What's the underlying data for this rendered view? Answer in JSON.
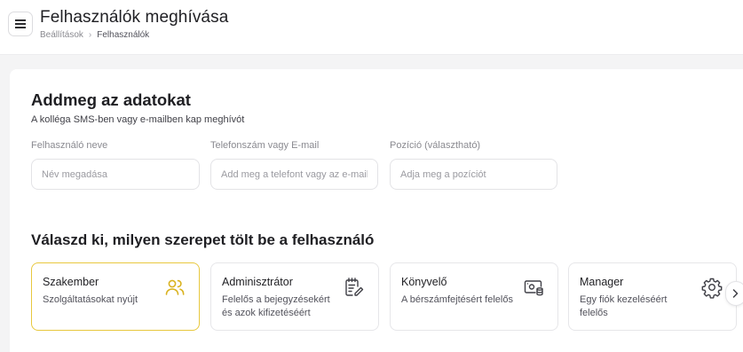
{
  "header": {
    "title": "Felhasználók meghívása",
    "breadcrumb": [
      "Beállítások",
      "Felhasználók"
    ],
    "menu_icon": "hamburger-icon"
  },
  "details": {
    "title": "Addmeg az adatokat",
    "subtitle": "A kolléga SMS-ben vagy e-mailben kap meghívót",
    "fields": [
      {
        "label": "Felhasználó neve",
        "placeholder": "Név megadása",
        "value": ""
      },
      {
        "label": "Telefonszám vagy E-mail",
        "placeholder": "Add meg a telefont vagy az e-mail címét",
        "value": ""
      },
      {
        "label": "Pozíció (választható)",
        "placeholder": "Adja meg a pozíciót",
        "value": ""
      }
    ]
  },
  "roles": {
    "title": "Válaszd ki, milyen szerepet tölt be a felhasználó",
    "selected_color": "#e8c83e",
    "items": [
      {
        "title": "Szakember",
        "description": "Szolgáltatásokat nyújt",
        "icon": "users-icon",
        "selected": true
      },
      {
        "title": "Adminisztrátor",
        "description": "Felelős a bejegyzésekért és azok kifizetéséért",
        "icon": "edit-document-icon",
        "selected": false
      },
      {
        "title": "Könyvelő",
        "description": "A bérszámfejtésért felelős",
        "icon": "cash-icon",
        "selected": false
      },
      {
        "title": "Manager",
        "description": "Egy fiók kezeléséért felelős",
        "icon": "gear-icon",
        "selected": false
      }
    ],
    "next_icon": "chevron-right-icon"
  }
}
